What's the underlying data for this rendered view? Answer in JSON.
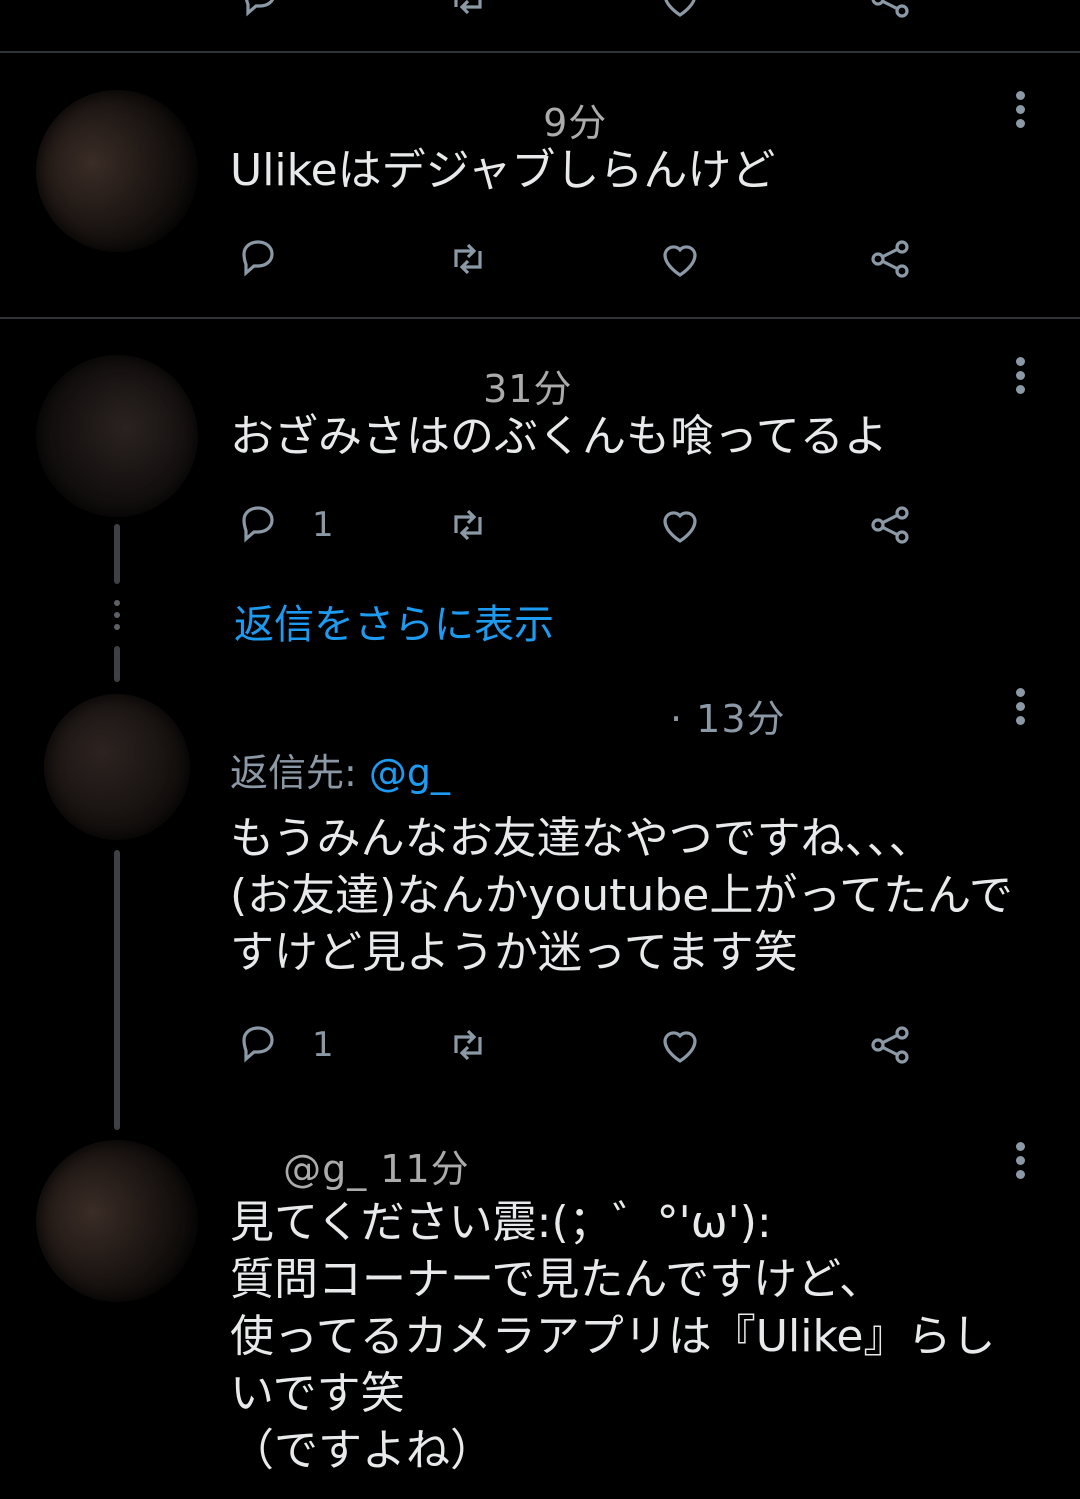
{
  "tweets": [
    {
      "header": "9分",
      "text_lines": [
        "Ulikeはデジャブしらんけど"
      ],
      "reply_count": ""
    },
    {
      "header": "31分",
      "text_lines": [
        "おざみさはのぶくんも喰ってるよ"
      ],
      "reply_count": "1"
    },
    {
      "header": "· 13分",
      "reply_to_label": "返信先:",
      "reply_to_handle": "@g_",
      "text_lines": [
        "もうみんなお友達なやつですね、、、",
        "(お友達)なんかyoutube上がってたんで",
        "すけど見ようか迷ってます笑"
      ],
      "reply_count": "1"
    },
    {
      "header": "@g_  11分",
      "text_lines": [
        "見てください震:(；゛°'ω'):",
        "質問コーナーで見たんですけど、",
        "使ってるカメラアプリは『Ulike』らし",
        "いです笑",
        "（ですよね）"
      ]
    }
  ],
  "show_more_replies": "返信をさらに表示",
  "icons": {
    "reply": "reply-icon",
    "retweet": "retweet-icon",
    "like": "heart-icon",
    "share": "share-icon",
    "more": "more-vertical-icon"
  },
  "colors": {
    "background": "#000000",
    "text": "#e7e9ea",
    "secondary": "#8b98a5",
    "link": "#1d9bf0",
    "divider": "#2f3336"
  }
}
